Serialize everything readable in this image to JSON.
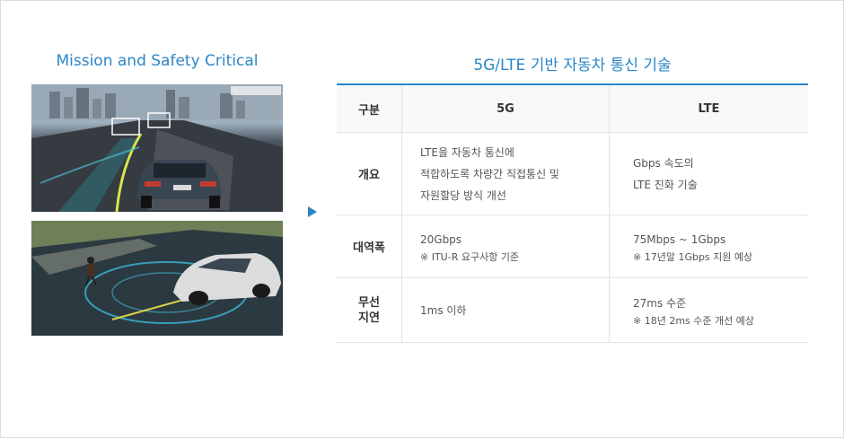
{
  "left": {
    "title": "Mission and Safety Critical"
  },
  "right": {
    "title": "5G/LTE 기반 자동차 통신 기술"
  },
  "table": {
    "headers": [
      "구분",
      "5G",
      "LTE"
    ],
    "rows": [
      {
        "label": "개요",
        "g5": [
          "LTE을 자동차 통신에",
          "적합하도록 차량간 직접통신 및",
          "자원할당 방식 개선"
        ],
        "lte": [
          "Gbps 속도의",
          "LTE 진화 기술"
        ]
      },
      {
        "label": "대역폭",
        "g5_main": "20Gbps",
        "g5_note": "※ ITU-R 요구사항 기준",
        "lte_main": "75Mbps ~ 1Gbps",
        "lte_note": "※ 17년말 1Gbps 지원 예상"
      },
      {
        "label_lines": [
          "무선",
          "지연"
        ],
        "g5_main": "1ms 이하",
        "lte_main": "27ms 수준",
        "lte_note": "※ 18년 2ms 수준 개선 예상"
      }
    ]
  },
  "colors": {
    "accent": "#2a86c6"
  }
}
